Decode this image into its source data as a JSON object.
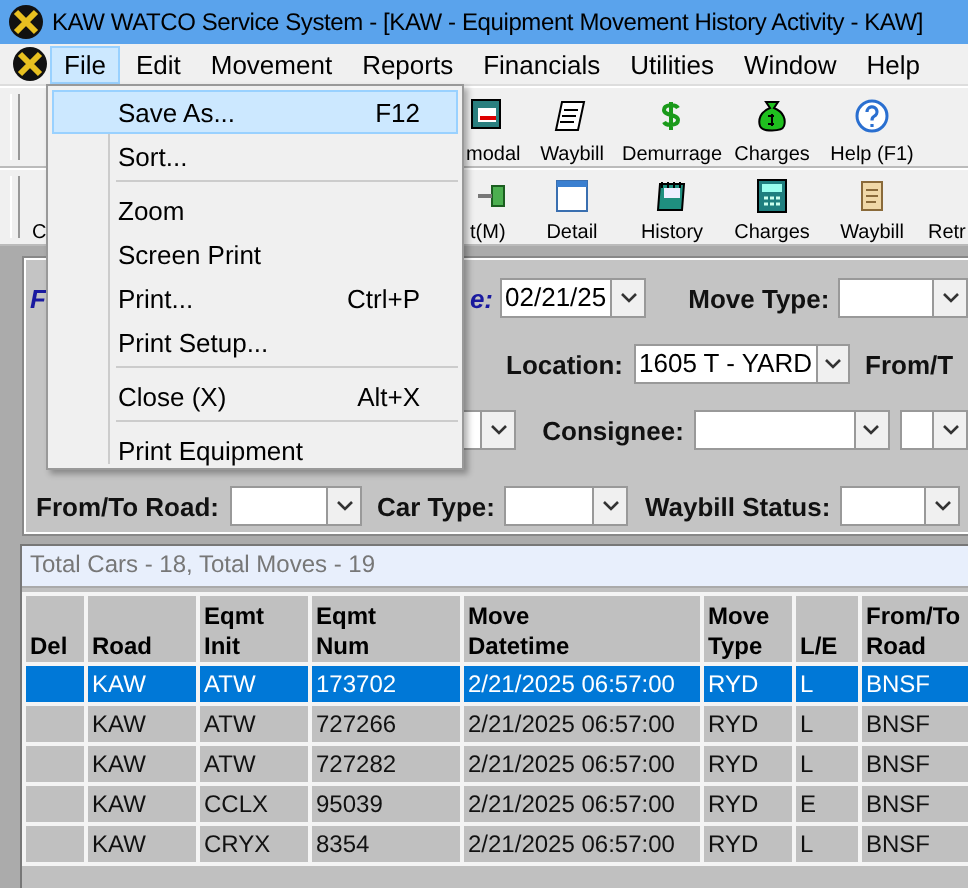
{
  "window": {
    "title": "KAW WATCO Service System - [KAW - Equipment Movement History Activity - KAW]"
  },
  "menu_bar": [
    {
      "label": "File",
      "selected": true
    },
    {
      "label": "Edit",
      "selected": false
    },
    {
      "label": "Movement",
      "selected": false
    },
    {
      "label": "Reports",
      "selected": false
    },
    {
      "label": "Financials",
      "selected": false
    },
    {
      "label": "Utilities",
      "selected": false
    },
    {
      "label": "Window",
      "selected": false
    },
    {
      "label": "Help",
      "selected": false
    }
  ],
  "file_menu": [
    {
      "kind": "item",
      "label": "Save As...",
      "shortcut": "F12",
      "selected": true
    },
    {
      "kind": "item",
      "label": "Sort...",
      "selected": false
    },
    {
      "kind": "separator"
    },
    {
      "kind": "item",
      "label": "Zoom",
      "selected": false
    },
    {
      "kind": "item",
      "label": "Screen Print",
      "selected": false
    },
    {
      "kind": "item",
      "label": "Print...",
      "shortcut": "Ctrl+P",
      "selected": false
    },
    {
      "kind": "item",
      "label": "Print Setup...",
      "selected": false
    },
    {
      "kind": "separator"
    },
    {
      "kind": "item",
      "label": "Close (X)",
      "shortcut": "Alt+X",
      "selected": false
    },
    {
      "kind": "separator"
    },
    {
      "kind": "item",
      "label": "Print Equipment",
      "selected": false
    }
  ],
  "toolbar_1": [
    {
      "label": "modal"
    },
    {
      "label": "Waybill"
    },
    {
      "label": "Demurrage"
    },
    {
      "label": "Charges"
    },
    {
      "label": "Help (F1)"
    }
  ],
  "toolbar_2": [
    {
      "label": "C"
    },
    {
      "label": "t(M)"
    },
    {
      "label": "Detail"
    },
    {
      "label": "History"
    },
    {
      "label": "Charges"
    },
    {
      "label": "Waybill"
    },
    {
      "label": "Retr"
    }
  ],
  "filters": {
    "title": "F",
    "rows": [
      {
        "items": [
          {
            "kind": "caption",
            "text": "e:"
          },
          {
            "kind": "combo",
            "value": "02/21/25"
          },
          {
            "kind": "label",
            "text": "Move Type:"
          },
          {
            "kind": "combo"
          }
        ]
      },
      {
        "items": [
          {
            "kind": "label",
            "text": "Location:"
          },
          {
            "kind": "combo",
            "value": "1605 T - YARD"
          },
          {
            "kind": "label",
            "text": "From/T"
          }
        ]
      },
      {
        "items": [
          {
            "kind": "combo"
          },
          {
            "kind": "label",
            "text": "Consignee:"
          },
          {
            "kind": "combo"
          },
          {
            "kind": "combo"
          }
        ]
      },
      {
        "items": [
          {
            "kind": "label",
            "text": "From/To Road:"
          },
          {
            "kind": "combo"
          },
          {
            "kind": "label",
            "text": "Car Type:"
          },
          {
            "kind": "combo"
          },
          {
            "kind": "label",
            "text": "Waybill Status:"
          },
          {
            "kind": "combo"
          }
        ]
      }
    ]
  },
  "grid": {
    "summary": "Total Cars - 18, Total Moves - 19",
    "columns": [
      "Del",
      "Road",
      "Eqmt Init",
      "Eqmt Num",
      "Move Datetime",
      "Move Type",
      "L/E",
      "From/To Road"
    ],
    "rows": [
      {
        "selected": true,
        "cells": [
          "",
          "KAW",
          "ATW",
          "173702",
          "2/21/2025 06:57:00",
          "RYD",
          "L",
          "BNSF"
        ]
      },
      {
        "selected": false,
        "cells": [
          "",
          "KAW",
          "ATW",
          "727266",
          "2/21/2025 06:57:00",
          "RYD",
          "L",
          "BNSF"
        ]
      },
      {
        "selected": false,
        "cells": [
          "",
          "KAW",
          "ATW",
          "727282",
          "2/21/2025 06:57:00",
          "RYD",
          "L",
          "BNSF"
        ]
      },
      {
        "selected": false,
        "cells": [
          "",
          "KAW",
          "CCLX",
          "95039",
          "2/21/2025 06:57:00",
          "RYD",
          "E",
          "BNSF"
        ]
      },
      {
        "selected": false,
        "cells": [
          "",
          "KAW",
          "CRYX",
          "8354",
          "2/21/2025 06:57:00",
          "RYD",
          "L",
          "BNSF"
        ]
      }
    ]
  }
}
